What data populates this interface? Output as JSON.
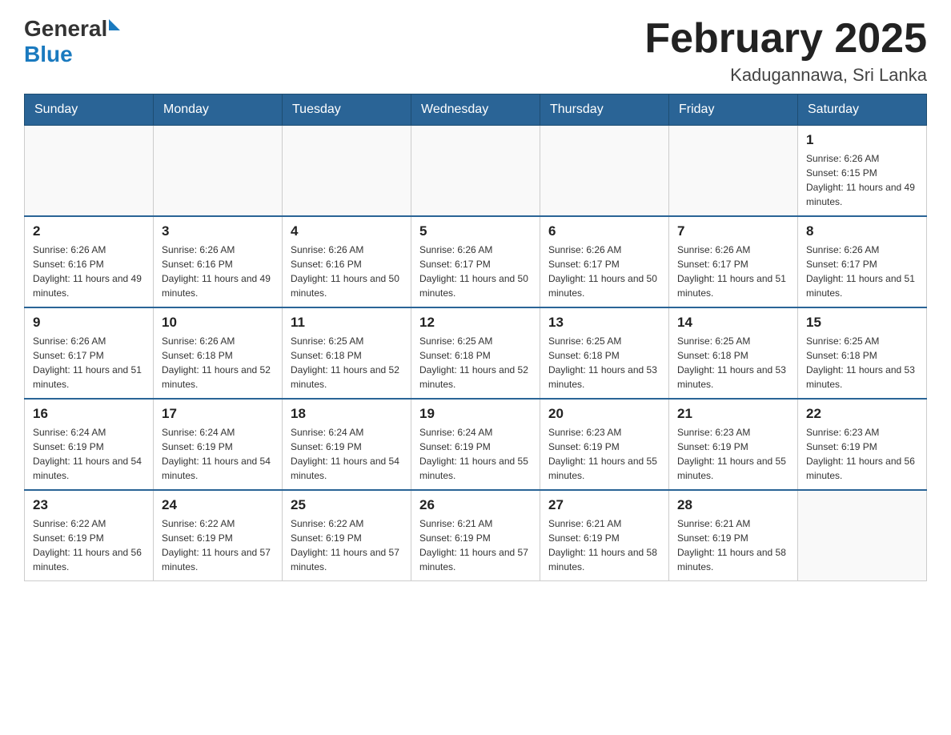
{
  "header": {
    "logo_general": "General",
    "logo_blue": "Blue",
    "month_year": "February 2025",
    "location": "Kadugannawa, Sri Lanka"
  },
  "days_of_week": [
    "Sunday",
    "Monday",
    "Tuesday",
    "Wednesday",
    "Thursday",
    "Friday",
    "Saturday"
  ],
  "weeks": [
    [
      {
        "day": "",
        "sunrise": "",
        "sunset": "",
        "daylight": ""
      },
      {
        "day": "",
        "sunrise": "",
        "sunset": "",
        "daylight": ""
      },
      {
        "day": "",
        "sunrise": "",
        "sunset": "",
        "daylight": ""
      },
      {
        "day": "",
        "sunrise": "",
        "sunset": "",
        "daylight": ""
      },
      {
        "day": "",
        "sunrise": "",
        "sunset": "",
        "daylight": ""
      },
      {
        "day": "",
        "sunrise": "",
        "sunset": "",
        "daylight": ""
      },
      {
        "day": "1",
        "sunrise": "Sunrise: 6:26 AM",
        "sunset": "Sunset: 6:15 PM",
        "daylight": "Daylight: 11 hours and 49 minutes."
      }
    ],
    [
      {
        "day": "2",
        "sunrise": "Sunrise: 6:26 AM",
        "sunset": "Sunset: 6:16 PM",
        "daylight": "Daylight: 11 hours and 49 minutes."
      },
      {
        "day": "3",
        "sunrise": "Sunrise: 6:26 AM",
        "sunset": "Sunset: 6:16 PM",
        "daylight": "Daylight: 11 hours and 49 minutes."
      },
      {
        "day": "4",
        "sunrise": "Sunrise: 6:26 AM",
        "sunset": "Sunset: 6:16 PM",
        "daylight": "Daylight: 11 hours and 50 minutes."
      },
      {
        "day": "5",
        "sunrise": "Sunrise: 6:26 AM",
        "sunset": "Sunset: 6:17 PM",
        "daylight": "Daylight: 11 hours and 50 minutes."
      },
      {
        "day": "6",
        "sunrise": "Sunrise: 6:26 AM",
        "sunset": "Sunset: 6:17 PM",
        "daylight": "Daylight: 11 hours and 50 minutes."
      },
      {
        "day": "7",
        "sunrise": "Sunrise: 6:26 AM",
        "sunset": "Sunset: 6:17 PM",
        "daylight": "Daylight: 11 hours and 51 minutes."
      },
      {
        "day": "8",
        "sunrise": "Sunrise: 6:26 AM",
        "sunset": "Sunset: 6:17 PM",
        "daylight": "Daylight: 11 hours and 51 minutes."
      }
    ],
    [
      {
        "day": "9",
        "sunrise": "Sunrise: 6:26 AM",
        "sunset": "Sunset: 6:17 PM",
        "daylight": "Daylight: 11 hours and 51 minutes."
      },
      {
        "day": "10",
        "sunrise": "Sunrise: 6:26 AM",
        "sunset": "Sunset: 6:18 PM",
        "daylight": "Daylight: 11 hours and 52 minutes."
      },
      {
        "day": "11",
        "sunrise": "Sunrise: 6:25 AM",
        "sunset": "Sunset: 6:18 PM",
        "daylight": "Daylight: 11 hours and 52 minutes."
      },
      {
        "day": "12",
        "sunrise": "Sunrise: 6:25 AM",
        "sunset": "Sunset: 6:18 PM",
        "daylight": "Daylight: 11 hours and 52 minutes."
      },
      {
        "day": "13",
        "sunrise": "Sunrise: 6:25 AM",
        "sunset": "Sunset: 6:18 PM",
        "daylight": "Daylight: 11 hours and 53 minutes."
      },
      {
        "day": "14",
        "sunrise": "Sunrise: 6:25 AM",
        "sunset": "Sunset: 6:18 PM",
        "daylight": "Daylight: 11 hours and 53 minutes."
      },
      {
        "day": "15",
        "sunrise": "Sunrise: 6:25 AM",
        "sunset": "Sunset: 6:18 PM",
        "daylight": "Daylight: 11 hours and 53 minutes."
      }
    ],
    [
      {
        "day": "16",
        "sunrise": "Sunrise: 6:24 AM",
        "sunset": "Sunset: 6:19 PM",
        "daylight": "Daylight: 11 hours and 54 minutes."
      },
      {
        "day": "17",
        "sunrise": "Sunrise: 6:24 AM",
        "sunset": "Sunset: 6:19 PM",
        "daylight": "Daylight: 11 hours and 54 minutes."
      },
      {
        "day": "18",
        "sunrise": "Sunrise: 6:24 AM",
        "sunset": "Sunset: 6:19 PM",
        "daylight": "Daylight: 11 hours and 54 minutes."
      },
      {
        "day": "19",
        "sunrise": "Sunrise: 6:24 AM",
        "sunset": "Sunset: 6:19 PM",
        "daylight": "Daylight: 11 hours and 55 minutes."
      },
      {
        "day": "20",
        "sunrise": "Sunrise: 6:23 AM",
        "sunset": "Sunset: 6:19 PM",
        "daylight": "Daylight: 11 hours and 55 minutes."
      },
      {
        "day": "21",
        "sunrise": "Sunrise: 6:23 AM",
        "sunset": "Sunset: 6:19 PM",
        "daylight": "Daylight: 11 hours and 55 minutes."
      },
      {
        "day": "22",
        "sunrise": "Sunrise: 6:23 AM",
        "sunset": "Sunset: 6:19 PM",
        "daylight": "Daylight: 11 hours and 56 minutes."
      }
    ],
    [
      {
        "day": "23",
        "sunrise": "Sunrise: 6:22 AM",
        "sunset": "Sunset: 6:19 PM",
        "daylight": "Daylight: 11 hours and 56 minutes."
      },
      {
        "day": "24",
        "sunrise": "Sunrise: 6:22 AM",
        "sunset": "Sunset: 6:19 PM",
        "daylight": "Daylight: 11 hours and 57 minutes."
      },
      {
        "day": "25",
        "sunrise": "Sunrise: 6:22 AM",
        "sunset": "Sunset: 6:19 PM",
        "daylight": "Daylight: 11 hours and 57 minutes."
      },
      {
        "day": "26",
        "sunrise": "Sunrise: 6:21 AM",
        "sunset": "Sunset: 6:19 PM",
        "daylight": "Daylight: 11 hours and 57 minutes."
      },
      {
        "day": "27",
        "sunrise": "Sunrise: 6:21 AM",
        "sunset": "Sunset: 6:19 PM",
        "daylight": "Daylight: 11 hours and 58 minutes."
      },
      {
        "day": "28",
        "sunrise": "Sunrise: 6:21 AM",
        "sunset": "Sunset: 6:19 PM",
        "daylight": "Daylight: 11 hours and 58 minutes."
      },
      {
        "day": "",
        "sunrise": "",
        "sunset": "",
        "daylight": ""
      }
    ]
  ]
}
